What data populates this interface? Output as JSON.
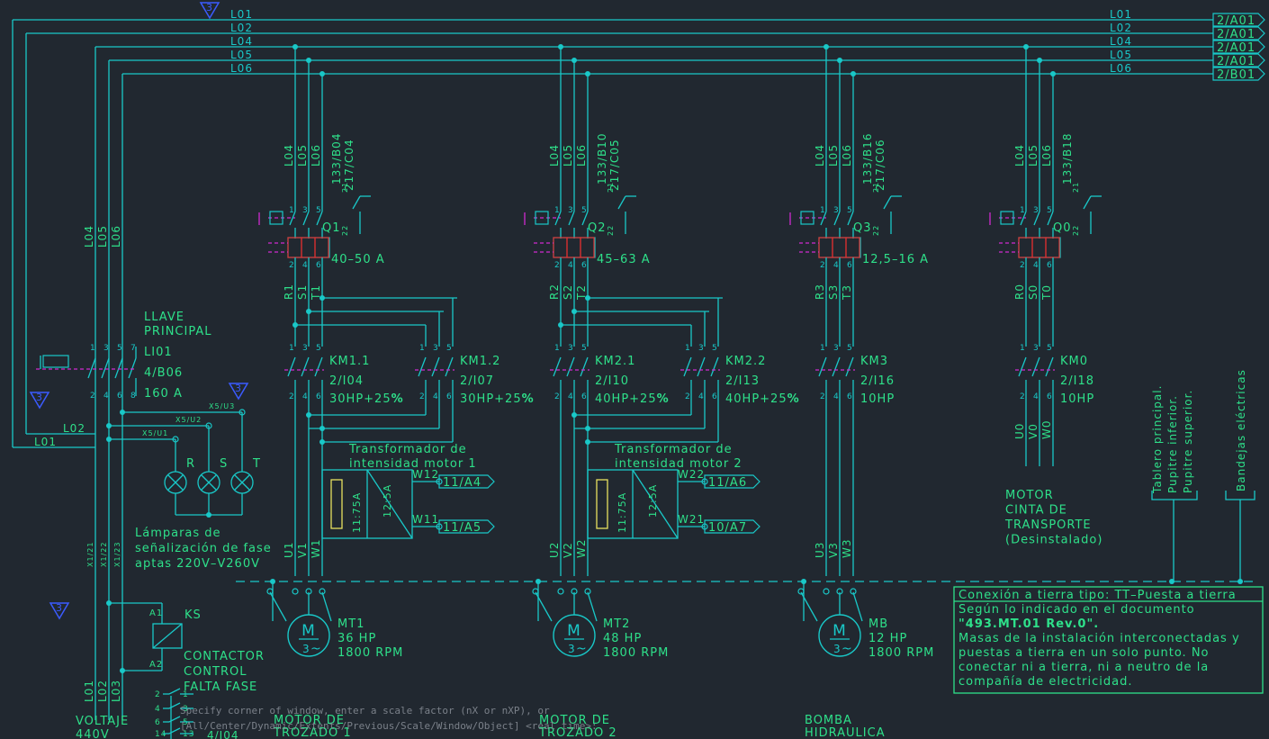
{
  "colors": {
    "background": "#212830",
    "wire": "#19c8c8",
    "text_green": "#2ee08a",
    "text_cyan": "#19c8c8",
    "accent_magenta": "#d02ad0",
    "accent_red": "#e03030",
    "box_yellow": "#e8e060"
  },
  "buses": {
    "left_labels": [
      "L01",
      "L02",
      "L04",
      "L05",
      "L06"
    ],
    "right_labels": [
      "L01",
      "L02",
      "L04",
      "L05",
      "L06"
    ],
    "refs": [
      "2/A01",
      "2/A01",
      "2/A01",
      "2/A01",
      "2/B01"
    ],
    "mark": "3"
  },
  "main_switch": {
    "title": "LLAVE",
    "title2": "PRINCIPAL",
    "tag": "LI01",
    "ref": "4/B06",
    "rating": "160 A",
    "top_pins": [
      "1",
      "3",
      "5",
      "7"
    ],
    "bottom_pins": [
      "2",
      "4",
      "6",
      "8"
    ],
    "vertical_labels": [
      "L04",
      "L05",
      "L06"
    ],
    "lower_labels": [
      "L02",
      "L01"
    ]
  },
  "lamps": {
    "labels": [
      "R",
      "S",
      "T"
    ],
    "taps": [
      "X5/U1",
      "X5/U2",
      "X5/U3"
    ],
    "caption": [
      "Lámparas de",
      "señalización de fase",
      "aptas 220V–V260V"
    ],
    "terminal_labels": [
      "X1/21",
      "X1/22",
      "X1/23"
    ]
  },
  "ks_relay": {
    "tag": "KS",
    "a1": "A1",
    "a2": "A2",
    "caption": [
      "CONTACTOR",
      "CONTROL",
      "FALTA FASE"
    ],
    "contacts": [
      "2",
      "4",
      "6",
      "14"
    ],
    "contacts_right": [
      "1",
      "3",
      "5",
      "13"
    ],
    "ref": "4/I04",
    "wire_labels": [
      "L01",
      "L02",
      "L03"
    ]
  },
  "voltage": {
    "label": "VOLTAJE",
    "value": "440V"
  },
  "columns": [
    {
      "feed_labels": [
        "L04",
        "L05",
        "L06"
      ],
      "ref_a": "133/B04",
      "ref_b": "217/C04",
      "breaker_tag": "Q1",
      "breaker_range": "40–50 A",
      "phase_labels": [
        "R1",
        "S1",
        "T1"
      ],
      "contactors": [
        {
          "tag": "KM1.1",
          "ref": "2/I04",
          "rating": "30HP+25",
          "pct": "%"
        },
        {
          "tag": "KM1.2",
          "ref": "2/I07",
          "rating": "30HP+25",
          "pct": "%"
        }
      ],
      "transformer_caption": [
        "Transformador de",
        "intensidad motor 1"
      ],
      "ct_left": "11:75A",
      "ct_right": "12:5A",
      "ct_out": [
        {
          "wire": "W12",
          "ref": "11/A4"
        },
        {
          "wire": "W11",
          "ref": "11/A5"
        }
      ],
      "motor_wires": [
        "U1",
        "V1",
        "W1"
      ],
      "motor_tag": "MT1",
      "motor_power": "36 HP",
      "motor_rpm": "1800 RPM",
      "motor_caption": [
        "MOTOR DE",
        "TROZADO 1"
      ]
    },
    {
      "feed_labels": [
        "L04",
        "L05",
        "L06"
      ],
      "ref_a": "133/B10",
      "ref_b": "217/C05",
      "breaker_tag": "Q2",
      "breaker_range": "45–63 A",
      "phase_labels": [
        "R2",
        "S2",
        "T2"
      ],
      "contactors": [
        {
          "tag": "KM2.1",
          "ref": "2/I10",
          "rating": "40HP+25",
          "pct": "%"
        },
        {
          "tag": "KM2.2",
          "ref": "2/I13",
          "rating": "40HP+25",
          "pct": "%"
        }
      ],
      "transformer_caption": [
        "Transformador de",
        "intensidad motor 2"
      ],
      "ct_left": "11:75A",
      "ct_right": "12:5A",
      "ct_out": [
        {
          "wire": "W22",
          "ref": "11/A6"
        },
        {
          "wire": "W21",
          "ref": "10/A7"
        }
      ],
      "motor_wires": [
        "U2",
        "V2",
        "W2"
      ],
      "motor_tag": "MT2",
      "motor_power": "48 HP",
      "motor_rpm": "1800 RPM",
      "motor_caption": [
        "MOTOR DE",
        "TROZADO 2"
      ]
    },
    {
      "feed_labels": [
        "L04",
        "L05",
        "L06"
      ],
      "ref_a": "133/B16",
      "ref_b": "217/C06",
      "breaker_tag": "Q3",
      "breaker_range": "12,5–16 A",
      "phase_labels": [
        "R3",
        "S3",
        "T3"
      ],
      "contactors": [
        {
          "tag": "KM3",
          "ref": "2/I16",
          "rating": "10HP",
          "pct": ""
        }
      ],
      "motor_wires": [
        "U3",
        "V3",
        "W3"
      ],
      "motor_tag": "MB",
      "motor_power": "12 HP",
      "motor_rpm": "1800 RPM",
      "motor_caption": [
        "BOMBA",
        "HIDRAULICA"
      ]
    },
    {
      "feed_labels": [
        "L04",
        "L05",
        "L06"
      ],
      "ref_a": "133/B18",
      "ref_b": "",
      "breaker_tag": "Q0",
      "breaker_range": "",
      "phase_labels": [
        "R0",
        "S0",
        "T0"
      ],
      "contactors": [
        {
          "tag": "KM0",
          "ref": "2/I18",
          "rating": "10HP",
          "pct": ""
        }
      ],
      "motor_wires": [
        "U0",
        "V0",
        "W0"
      ],
      "motor_caption": [
        "MOTOR",
        "CINTA DE",
        "TRANSPORTE",
        "(Desinstalado)"
      ]
    }
  ],
  "breaker_pins": {
    "top": [
      "1",
      "3",
      "5"
    ],
    "bottom": [
      "2",
      "4",
      "6"
    ],
    "aux_top": "21",
    "aux_bottom": "22",
    "aux_right_top": "13",
    "aux_right_bottom": "14"
  },
  "contactor_pins": {
    "top": [
      "1",
      "3",
      "5"
    ],
    "bottom": [
      "2",
      "4",
      "6"
    ]
  },
  "motor_symbol": {
    "letter": "M",
    "phase": "3",
    "tilde": "~",
    "terminals": [
      "U1",
      "V1",
      "W1"
    ]
  },
  "ground": {
    "labels_a": [
      "Tablero principal.",
      "Pupitre inferior.",
      "Pupitre superior."
    ],
    "labels_b": "Bandejas eléctricas",
    "note_title": "Conexión a tierra tipo: TT–Puesta a tierra",
    "note_lines": [
      "Según lo indicado en el documento",
      "\"493.MT.01 Rev.0\".",
      "Masas de la instalación interconectadas y",
      "puestas a tierra en un solo punto. No",
      "conectar ni a tierra, ni a neutro de la",
      "compañía de electricidad."
    ]
  },
  "command_line": [
    "Specify corner of window, enter a scale factor (nX or nXP), or",
    "[All/Center/Dynamic/Extents/Previous/Scale/Window/Object] <real time>:"
  ]
}
